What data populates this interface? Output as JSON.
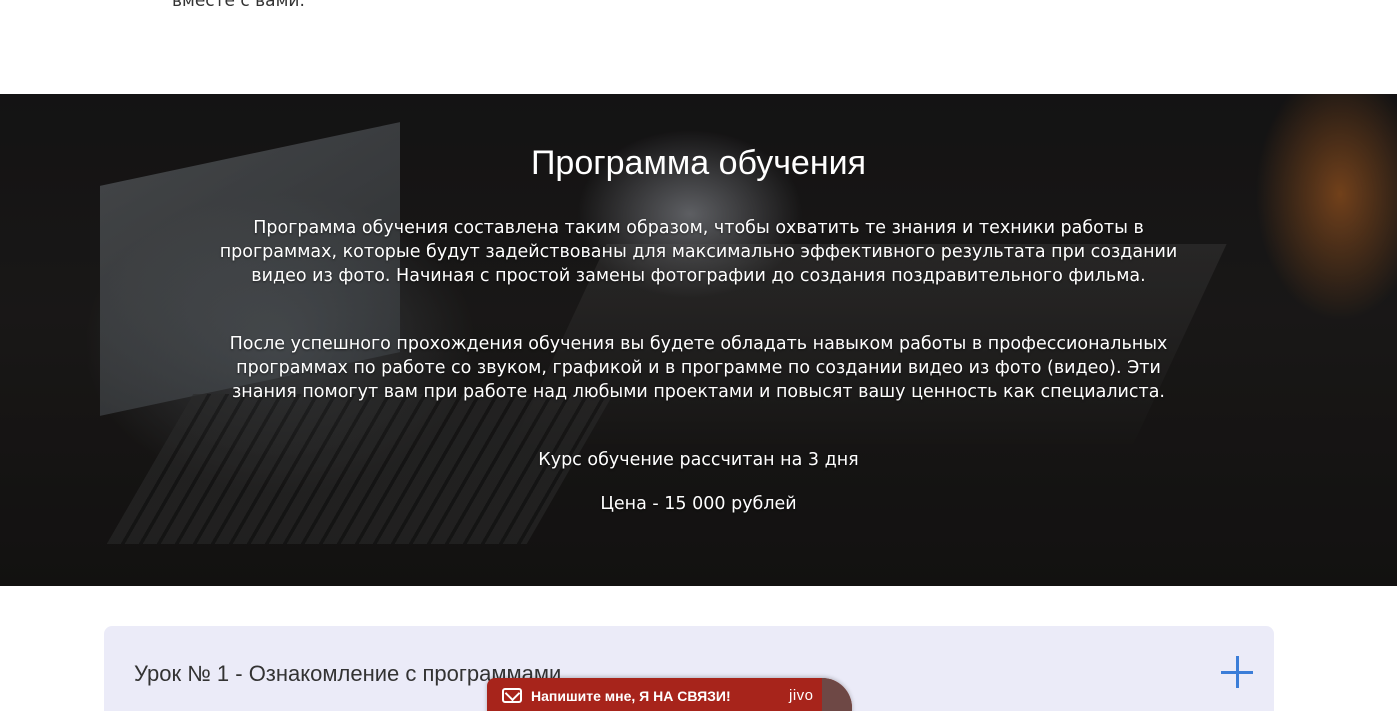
{
  "top_text": "вместе с вами.",
  "hero": {
    "title": "Программа обучения",
    "paragraph1": "Программа обучения составлена таким образом, чтобы охватить те знания и техники работы в программах, которые будут задействованы для максимально эффективного результата при создании видео из фото. Начиная с простой замены фотографии до создания поздравительного фильма.",
    "paragraph2": "После успешного прохождения обучения вы будете обладать навыком работы в профессиональных программах по работе со звуком, графикой и в программе по создании видео из фото (видео). Эти знания помогут вам при работе над любыми проектами и повысят вашу ценность как специалиста.",
    "duration": "Курс обучение рассчитан на 3 дня",
    "price": "Цена - 15 000 рублей"
  },
  "accordion": {
    "items": [
      {
        "title": "Урок № 1 - Ознакомление с программами",
        "icon": "plus-icon"
      }
    ]
  },
  "chat_widget": {
    "label": "Напишите мне, Я НА СВЯЗИ!",
    "brand": "jivo",
    "icon": "mail-icon"
  },
  "colors": {
    "accent": "#3b7dd8",
    "accordion_bg": "#ebebf8",
    "chat_bg": "#a7241b"
  }
}
